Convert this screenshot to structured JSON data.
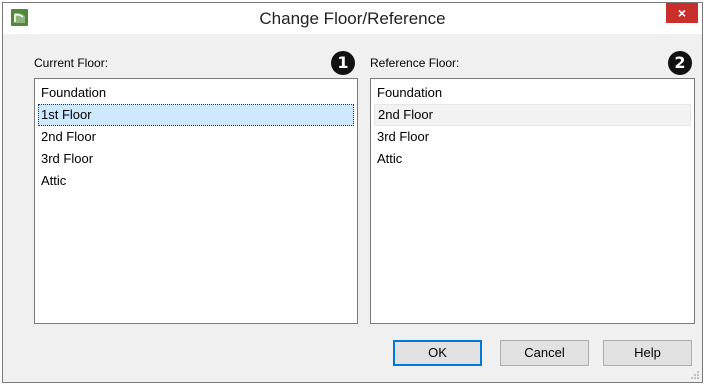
{
  "window": {
    "title": "Change Floor/Reference",
    "close_label": "×"
  },
  "current": {
    "label": "Current Floor:",
    "badge": "1",
    "items": [
      "Foundation",
      "1st Floor",
      "2nd Floor",
      "3rd Floor",
      "Attic"
    ],
    "selected": "1st Floor"
  },
  "reference": {
    "label": "Reference Floor:",
    "badge": "2",
    "items": [
      "Foundation",
      "2nd Floor",
      "3rd Floor",
      "Attic"
    ],
    "selected": "2nd Floor"
  },
  "buttons": {
    "ok": "OK",
    "cancel": "Cancel",
    "help": "Help"
  },
  "colors": {
    "close": "#c9302c",
    "selection": "#cde8ff",
    "app_icon": "#4f8a3a"
  }
}
